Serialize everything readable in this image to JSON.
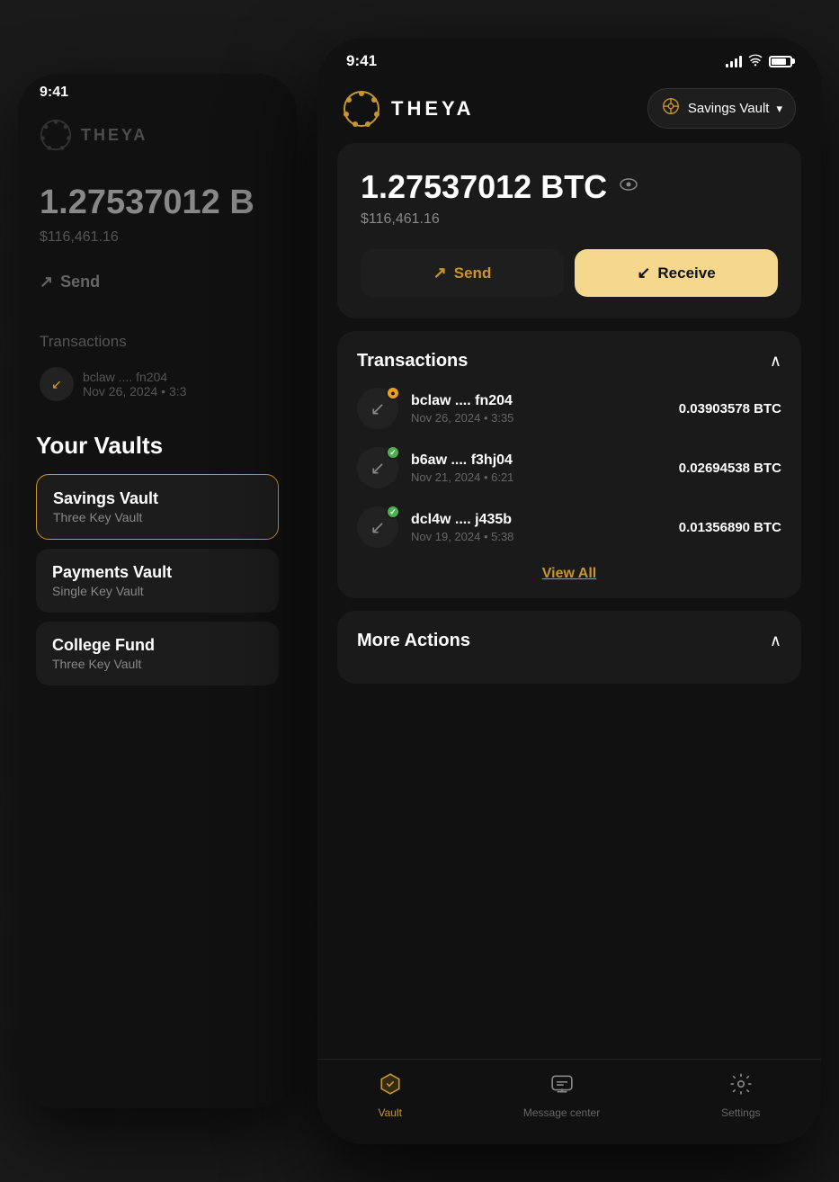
{
  "time": "9:41",
  "bg_phone": {
    "logo_text": "THEYA",
    "balance_btc": "1.27537012 B",
    "balance_usd": "$116,461.16",
    "send_label": "Send",
    "transactions_label": "Transactions",
    "tx1": {
      "name": "bclaw .... fn204",
      "date": "Nov 26, 2024 • 3:3"
    },
    "vaults_title": "Your Vaults",
    "vaults": [
      {
        "name": "Savings Vault",
        "type": "Three Key Vault",
        "active": true
      },
      {
        "name": "Payments Vault",
        "type": "Single Key Vault",
        "active": false
      },
      {
        "name": "College Fund",
        "type": "Three Key Vault",
        "active": false
      }
    ]
  },
  "fg_phone": {
    "logo_text": "THEYA",
    "vault_selector_label": "Savings Vault",
    "balance_btc": "1.27537012 BTC",
    "balance_usd": "$116,461.16",
    "send_label": "Send",
    "receive_label": "Receive",
    "transactions_section": {
      "title": "Transactions",
      "items": [
        {
          "name": "bclaw .... fn204",
          "date": "Nov 26, 2024 • 3:35",
          "amount": "0.03903578 BTC",
          "status": "pending"
        },
        {
          "name": "b6aw .... f3hj04",
          "date": "Nov 21, 2024 • 6:21",
          "amount": "0.02694538 BTC",
          "status": "confirmed"
        },
        {
          "name": "dcl4w .... j435b",
          "date": "Nov 19, 2024 • 5:38",
          "amount": "0.01356890 BTC",
          "status": "confirmed"
        }
      ],
      "view_all": "View All"
    },
    "more_actions_title": "More Actions",
    "nav": {
      "vault_label": "Vault",
      "messages_label": "Message center",
      "settings_label": "Settings"
    }
  }
}
